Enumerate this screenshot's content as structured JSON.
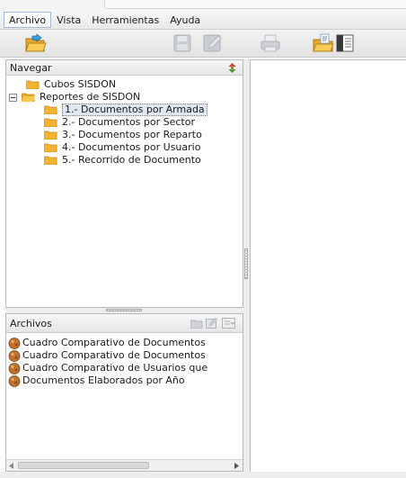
{
  "menu": {
    "items": [
      {
        "label": "Archivo",
        "active": true
      },
      {
        "label": "Vista"
      },
      {
        "label": "Herramientas"
      },
      {
        "label": "Ayuda"
      }
    ]
  },
  "toolbar": {
    "buttons": [
      {
        "name": "open-folder",
        "icon": "open-folder-icon",
        "enabled": true
      },
      {
        "name": "save",
        "icon": "save-icon",
        "enabled": false
      },
      {
        "name": "edit",
        "icon": "edit-icon",
        "enabled": false
      },
      {
        "name": "print",
        "icon": "print-icon",
        "enabled": false
      },
      {
        "name": "export",
        "icon": "export-folder-icon",
        "enabled": true
      },
      {
        "name": "view-panel",
        "icon": "panel-icon",
        "enabled": true
      }
    ]
  },
  "navigation": {
    "title": "Navegar",
    "tree": [
      {
        "label": "Cubos SISDON",
        "level": 1
      },
      {
        "label": "Reportes de SISDON",
        "level": 0,
        "expanded": true
      },
      {
        "label": "1.- Documentos por Armada",
        "level": 1,
        "selected": true
      },
      {
        "label": "2.- Documentos por Sector",
        "level": 1
      },
      {
        "label": "3.- Documentos por Reparto",
        "level": 1
      },
      {
        "label": "4.- Documentos por Usuario",
        "level": 1
      },
      {
        "label": "5.- Recorrido de Documento",
        "level": 1
      }
    ]
  },
  "files": {
    "title": "Archivos",
    "items": [
      "Cuadro Comparativo de Documentos",
      "Cuadro Comparativo de Documentos",
      "Cuadro Comparativo de Usuarios que",
      "Documentos Elaborados por Año"
    ]
  },
  "colors": {
    "folder": "#f2b431",
    "selection": "#dfe7f1",
    "file_icon": "#c0722f"
  }
}
